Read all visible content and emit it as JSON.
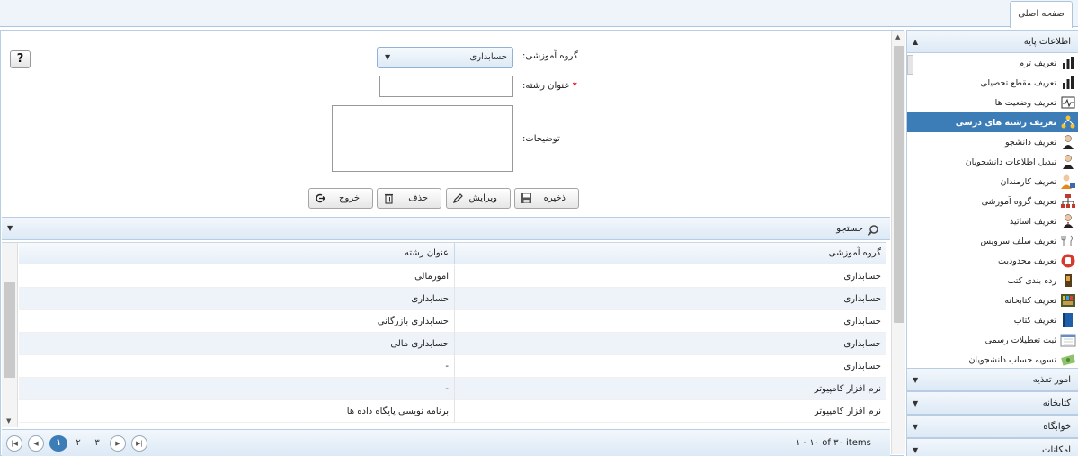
{
  "tabs": [
    {
      "label": "صفحه اصلی"
    }
  ],
  "sidebar": {
    "sections": [
      {
        "label": "اطلاعات پایه",
        "expanded": true
      },
      {
        "label": "امور تغذیه"
      },
      {
        "label": "کتابخانه"
      },
      {
        "label": "خوابگاه"
      },
      {
        "label": "امکانات"
      }
    ],
    "items": [
      {
        "label": "تعریف ترم",
        "icon": "bar-chart-icon"
      },
      {
        "label": "تعریف مقطع تحصیلی",
        "icon": "bar-chart-icon"
      },
      {
        "label": "تعریف وضعیت ها",
        "icon": "status-monitor-icon"
      },
      {
        "label": "تعریف رشته های درسی",
        "icon": "hierarchy-icon",
        "active": true
      },
      {
        "label": "تعریف دانشجو",
        "icon": "student-icon"
      },
      {
        "label": "تبدیل اطلاعات دانشجویان",
        "icon": "student-icon"
      },
      {
        "label": "تعریف کارمندان",
        "icon": "employee-icon"
      },
      {
        "label": "تعریف گروه آموزشی",
        "icon": "org-chart-icon"
      },
      {
        "label": "تعریف اساتید",
        "icon": "teacher-icon"
      },
      {
        "label": "تعریف سلف سرویس",
        "icon": "cutlery-icon"
      },
      {
        "label": "تعریف محدودیت",
        "icon": "stop-hand-icon"
      },
      {
        "label": "رده بندی کتب",
        "icon": "bookshelf-icon"
      },
      {
        "label": "تعریف کتابخانه",
        "icon": "library-icon"
      },
      {
        "label": "تعریف کتاب",
        "icon": "book-icon"
      },
      {
        "label": "ثبت تعطیلات رسمی",
        "icon": "calendar-icon"
      },
      {
        "label": "تسویه حساب دانشجویان",
        "icon": "money-icon"
      }
    ]
  },
  "form": {
    "help_label": "?",
    "group_label": "گروه آموزشی:",
    "group_value": "حسابداری",
    "title_label": "عنوان رشته:",
    "required_mark": "*",
    "title_value": "",
    "desc_label": "توضیحات:",
    "desc_value": ""
  },
  "actions": {
    "save": "ذخیره",
    "edit": "ویرایش",
    "delete": "حذف",
    "exit": "خروج"
  },
  "search": {
    "label": "جستجو"
  },
  "grid": {
    "columns": [
      "گروه آموزشی",
      "عنوان رشته"
    ],
    "rows": [
      [
        "حسابداری",
        "امورمالی"
      ],
      [
        "حسابداری",
        "حسابداری"
      ],
      [
        "حسابداری",
        "حسابداری بازرگانی"
      ],
      [
        "حسابداری",
        "حسابداری مالی"
      ],
      [
        "حسابداری",
        "-"
      ],
      [
        "نرم افزار کامپیوتر",
        "-"
      ],
      [
        "نرم افزار کامپیوتر",
        "برنامه نویسی پایگاه داده ها"
      ]
    ]
  },
  "pager": {
    "pages": [
      "۱",
      "۲",
      "۳"
    ],
    "current": "۱",
    "info": "۱ - ۱۰ of ۳۰ items"
  },
  "colors": {
    "accent": "#3c7db7",
    "header_bg": "#dde9f5",
    "border": "#b7cde3",
    "row_alt": "#eef3f9"
  }
}
